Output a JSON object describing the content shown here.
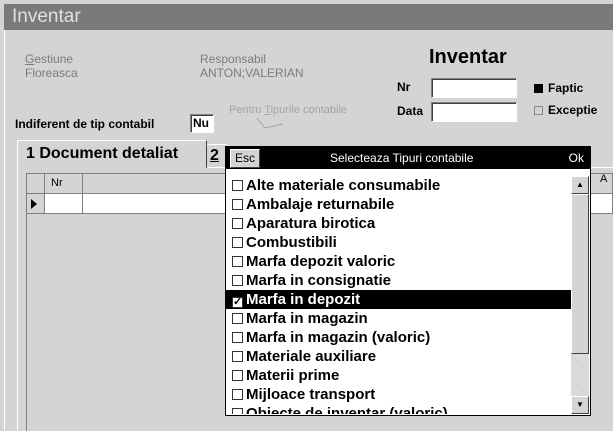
{
  "window": {
    "title": "Inventar"
  },
  "header": {
    "gestiune_label": "Gestiune",
    "gestiune_value": "Floreasca",
    "responsabil_label": "Responsabil",
    "responsabil_value": "ANTON;VALERIAN",
    "doc_title": "Inventar",
    "nr_label": "Nr",
    "data_label": "Data",
    "nr_value": "",
    "data_value": "",
    "indiferent_label": "Indiferent de tip contabil",
    "indiferent_value": "Nu",
    "pentru_tipuri_label": "Pentru Tipurile contabile",
    "faptic_label": "Faptic",
    "exceptie_label": "Exceptie"
  },
  "tabs": [
    {
      "label": "1 Document detaliat"
    },
    {
      "label": "2"
    }
  ],
  "grid": {
    "columns": [
      "Nr",
      "",
      "A"
    ]
  },
  "popup": {
    "esc_label": "Esc",
    "title": "Selecteaza Tipuri contabile",
    "ok_label": "Ok",
    "items": [
      {
        "label": "Alte materiale consumabile",
        "checked": false
      },
      {
        "label": "Ambalaje returnabile",
        "checked": false
      },
      {
        "label": "Aparatura birotica",
        "checked": false
      },
      {
        "label": "Combustibili",
        "checked": false
      },
      {
        "label": "Marfa depozit valoric",
        "checked": false
      },
      {
        "label": "Marfa in consignatie",
        "checked": false
      },
      {
        "label": "Marfa in depozit",
        "checked": true,
        "selected": true
      },
      {
        "label": "Marfa in magazin",
        "checked": false
      },
      {
        "label": "Marfa in magazin (valoric)",
        "checked": false
      },
      {
        "label": "Materiale auxiliare",
        "checked": false
      },
      {
        "label": "Materii prime",
        "checked": false
      },
      {
        "label": "Mijloace transport",
        "checked": false
      },
      {
        "label": "Obiecte de inventar (valoric)",
        "checked": false
      }
    ]
  }
}
